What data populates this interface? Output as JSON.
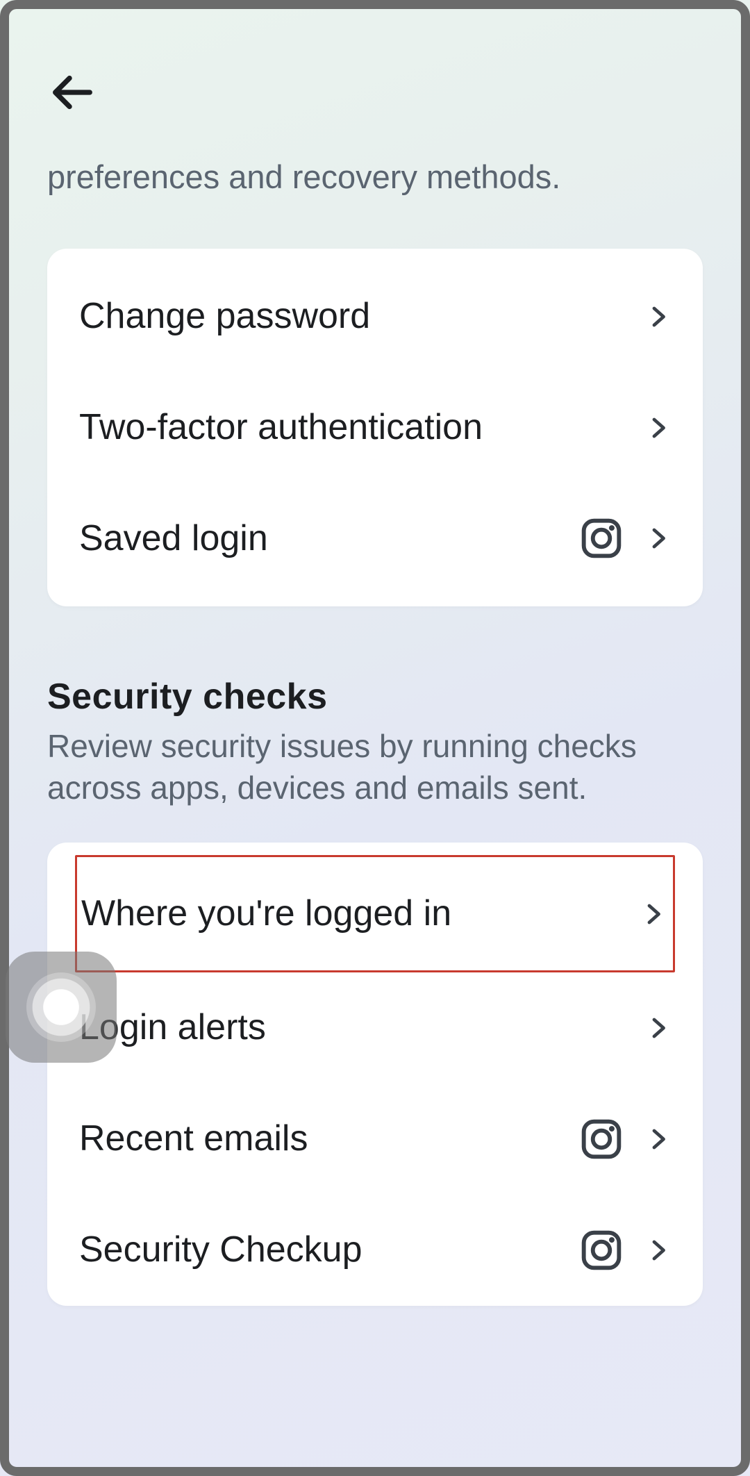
{
  "header": {
    "subtitle": "preferences and recovery methods."
  },
  "login_section": {
    "items": [
      {
        "label": "Change password",
        "instagram": false
      },
      {
        "label": "Two-factor authentication",
        "instagram": false
      },
      {
        "label": "Saved login",
        "instagram": true
      }
    ]
  },
  "security_section": {
    "title": "Security checks",
    "description": "Review security issues by running checks across apps, devices and emails sent.",
    "items": [
      {
        "label": "Where you're logged in",
        "instagram": false,
        "highlighted": true
      },
      {
        "label": "Login alerts",
        "instagram": false
      },
      {
        "label": "Recent emails",
        "instagram": true
      },
      {
        "label": "Security Checkup",
        "instagram": true
      }
    ]
  }
}
